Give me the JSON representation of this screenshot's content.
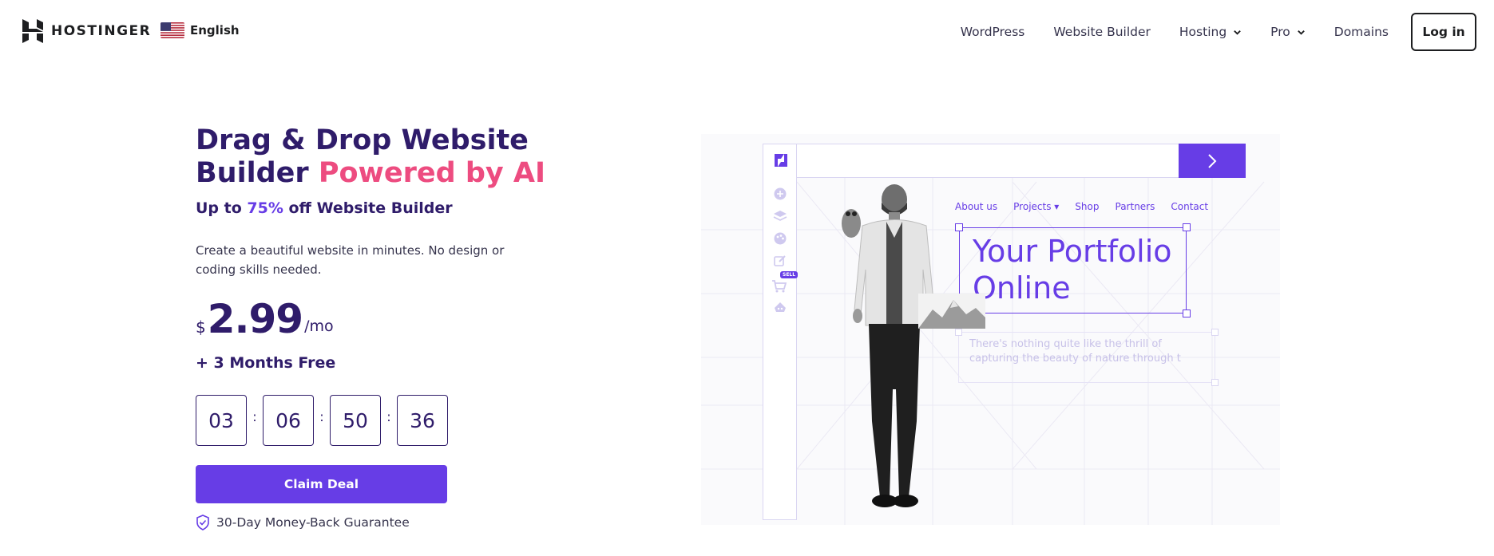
{
  "nav": {
    "brand": "HOSTINGER",
    "language": "English",
    "links": [
      {
        "label": "WordPress",
        "dropdown": false
      },
      {
        "label": "Website Builder",
        "dropdown": false
      },
      {
        "label": "Hosting",
        "dropdown": true
      },
      {
        "label": "Pro",
        "dropdown": true
      },
      {
        "label": "Domains",
        "dropdown": false
      }
    ],
    "login_label": "Log in"
  },
  "hero": {
    "title_part1": "Drag & Drop Website Builder ",
    "title_accent": "Powered by AI",
    "subtitle_prefix": "Up to ",
    "subtitle_pct": "75%",
    "subtitle_suffix": " off Website Builder",
    "description": "Create a beautiful website in minutes. No design or coding skills needed.",
    "price_currency": "$",
    "price_amount": "2.99",
    "price_period": "/mo",
    "bonus": "+ 3 Months Free",
    "timer": [
      "03",
      "06",
      "50",
      "36"
    ],
    "timer_separator": ":",
    "cta_label": "Claim Deal",
    "guarantee": "30-Day Money-Back Guarantee"
  },
  "visual": {
    "mini_nav": [
      "About us",
      "Projects ▾",
      "Shop",
      "Partners",
      "Contact"
    ],
    "portfolio_heading_line1": "Your Portfolio",
    "portfolio_heading_line2": "Online",
    "paragraph_line1": "There's nothing quite like the thrill of",
    "paragraph_line2": "capturing the beauty of nature through t",
    "sell_badge": "SELL"
  },
  "colors": {
    "primary": "#673de6",
    "accent": "#ed4c80",
    "heading": "#2f1c6a"
  }
}
